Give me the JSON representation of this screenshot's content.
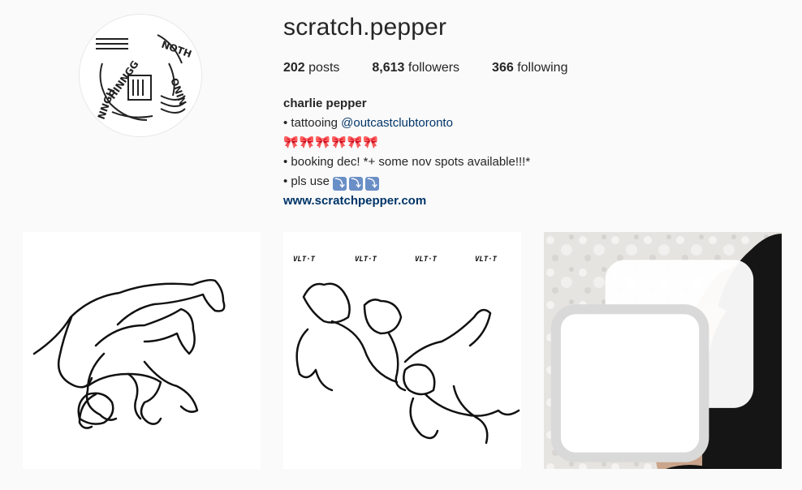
{
  "profile": {
    "username": "scratch.pepper",
    "avatar_icon": "profile-avatar-lettering"
  },
  "stats": {
    "posts_count": "202",
    "posts_label": "posts",
    "followers_count": "8,613",
    "followers_label": "followers",
    "following_count": "366",
    "following_label": "following"
  },
  "bio": {
    "name": "charlie pepper",
    "line1_prefix": "• tattooing ",
    "line1_mention": "@outcastclubtoronto",
    "line2_bows": "🎀🎀🎀🎀🎀🎀",
    "line3": "• booking dec! *+ some nov spots available!!!*",
    "line4_prefix": "• pls use ",
    "line4_arrows": [
      "⤵",
      "⤵",
      "⤵"
    ],
    "website": "www.scratchpepper.com"
  },
  "posts": [
    {
      "name": "post-horses-drawing",
      "icon": "horses-line-drawing"
    },
    {
      "name": "post-dogs-drawing",
      "icon": "dogs-line-drawing"
    },
    {
      "name": "post-arm-tattoo-photo",
      "icon": "multiple-photos-icon"
    }
  ],
  "colors": {
    "background": "#fafafa",
    "link": "#003569",
    "text": "#262626"
  }
}
